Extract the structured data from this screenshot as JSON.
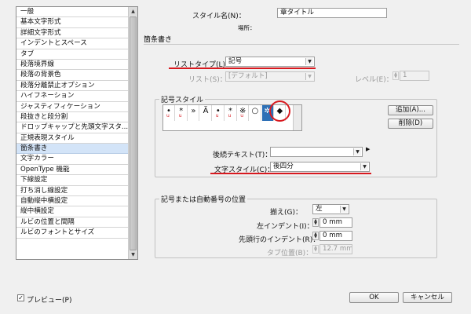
{
  "sidebar": {
    "items": [
      {
        "label": "一般",
        "selected": false
      },
      {
        "label": "基本文字形式",
        "selected": false
      },
      {
        "label": "詳細文字形式",
        "selected": false
      },
      {
        "label": "インデントとスペース",
        "selected": false
      },
      {
        "label": "タブ",
        "selected": false
      },
      {
        "label": "段落境界線",
        "selected": false
      },
      {
        "label": "段落の背景色",
        "selected": false
      },
      {
        "label": "段落分離禁止オプション",
        "selected": false
      },
      {
        "label": "ハイフネーション",
        "selected": false
      },
      {
        "label": "ジャスティフィケーション",
        "selected": false
      },
      {
        "label": "段抜きと段分割",
        "selected": false
      },
      {
        "label": "ドロップキャップと先頭文字スタ...",
        "selected": false
      },
      {
        "label": "正規表現スタイル",
        "selected": false
      },
      {
        "label": "箇条書き",
        "selected": true
      },
      {
        "label": "文字カラー",
        "selected": false
      },
      {
        "label": "OpenType 機能",
        "selected": false
      },
      {
        "label": "下線設定",
        "selected": false
      },
      {
        "label": "打ち消し線設定",
        "selected": false
      },
      {
        "label": "自動縦中横設定",
        "selected": false
      },
      {
        "label": "縦中横設定",
        "selected": false
      },
      {
        "label": "ルビの位置と間隔",
        "selected": false
      },
      {
        "label": "ルビのフォントとサイズ",
        "selected": false
      }
    ]
  },
  "header": {
    "style_name_label": "スタイル名(N)：",
    "style_name_value": "章タイトル",
    "location_label": "場所：",
    "section_title": "箇条書き"
  },
  "list_type": {
    "label": "リストタイプ(L)：",
    "value": "記号"
  },
  "list": {
    "label": "リスト(S)：",
    "value": "[デフォルト]",
    "level_label": "レベル(E)：",
    "level_value": "1"
  },
  "bullet_style": {
    "group_title": "記号スタイル",
    "bullets": [
      {
        "glyph": "•",
        "under": "u"
      },
      {
        "glyph": "*",
        "under": "u"
      },
      {
        "glyph": "»",
        "under": ""
      },
      {
        "glyph": "Ä",
        "under": ""
      },
      {
        "glyph": "•",
        "under": "u"
      },
      {
        "glyph": "*",
        "under": "u"
      },
      {
        "glyph": "※",
        "under": "u"
      },
      {
        "glyph": "○",
        "under": ""
      },
      {
        "glyph": "✲",
        "under": ""
      },
      {
        "glyph": "◆",
        "under": ""
      }
    ],
    "selected_index": 8,
    "add_button": "追加(A)...",
    "delete_button": "削除(D)",
    "text_after_label": "後続テキスト(T)：",
    "text_after_value": "",
    "char_style_label": "文字スタイル(C)：",
    "char_style_value": "後四分"
  },
  "position": {
    "group_title": "記号または自動番号の位置",
    "align_label": "揃え(G)：",
    "align_value": "左",
    "left_indent_label": "左インデント(I)：",
    "left_indent_value": "0 mm",
    "first_indent_label": "先頭行のインデント(R)：",
    "first_indent_value": "0 mm",
    "tab_label": "タブ位置(B)：",
    "tab_value": "12.7 mm"
  },
  "footer": {
    "preview_label": "プレビュー(P)",
    "preview_checked": true,
    "ok_label": "OK",
    "cancel_label": "キャンセル"
  },
  "colors": {
    "highlight_red": "#d8191f",
    "selection_blue": "#2d70b6",
    "list_selection": "#d3e4f8"
  }
}
